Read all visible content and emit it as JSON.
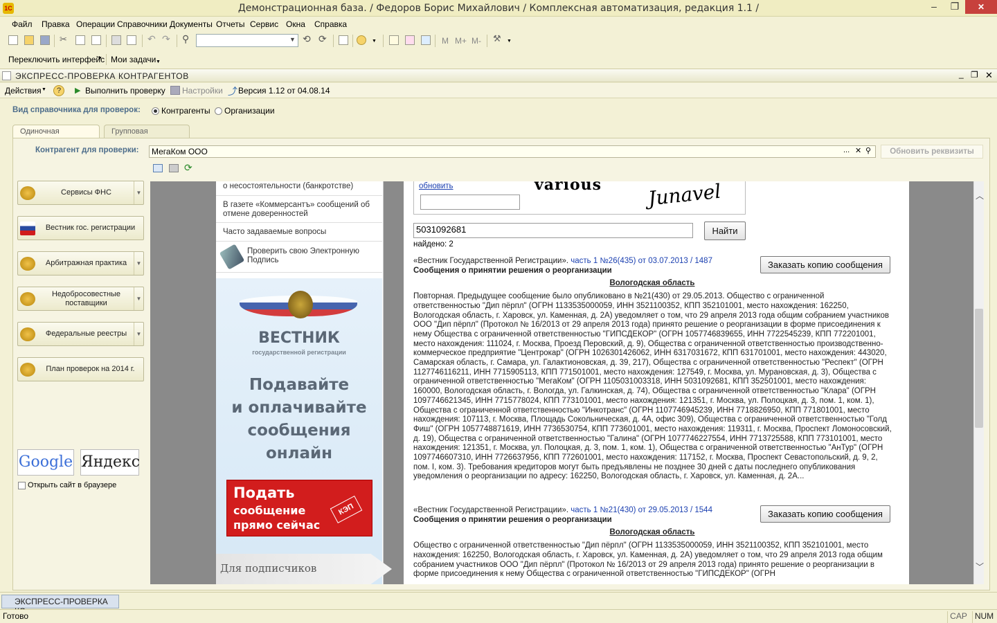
{
  "window": {
    "title": "Демонстрационная база. / Федоров Борис Михайлович /  Комплексная автоматизация, редакция 1.1 /",
    "app_icon": "1С",
    "minimize": "–",
    "restore": "❐",
    "close": "✕"
  },
  "menu": [
    "Файл",
    "Правка",
    "Операции",
    "Справочники",
    "Документы",
    "Отчеты",
    "Сервис",
    "Окна",
    "Справка"
  ],
  "toolbar2": {
    "switch_interface": "Переключить интерфейс",
    "my_tasks": "Мои задачи"
  },
  "toolbar": {
    "m1": "M",
    "m2": "M+",
    "m3": "M-",
    "search_value": ""
  },
  "document": {
    "title": "ЭКСПРЕСС-ПРОВЕРКА КОНТРАГЕНТОВ"
  },
  "actions": {
    "actions": "Действия",
    "help": "?",
    "run": "Выполнить проверку",
    "settings": "Настройки",
    "version": "Версия 1.12 от 04.08.14"
  },
  "ref_type": {
    "label": "Вид справочника для проверок:",
    "opt1": "Контрагенты",
    "opt2": "Организации",
    "selected": "Контрагенты"
  },
  "tabs": {
    "single": "Одиночная проверка",
    "group": "Групповая проверка",
    "active": "Одиночная проверка"
  },
  "contractor": {
    "label": "Контрагент для проверки:",
    "value": "МегаКом ООО",
    "refresh": "Обновить реквизиты",
    "dots": "...",
    "clear": "✕"
  },
  "services": [
    {
      "label": "Сервисы ФНС",
      "dropdown": true
    },
    {
      "label": "Вестник гос. регистрации",
      "dropdown": false
    },
    {
      "label": "Арбитражная практика",
      "dropdown": true
    },
    {
      "label": "Недобросовестные поставщики",
      "dropdown": true
    },
    {
      "label": "Федеральные реестры",
      "dropdown": true
    },
    {
      "label": "План проверок на 2014 г.",
      "dropdown": false
    }
  ],
  "search_engines": {
    "google": "Google",
    "yandex": "Яндекс"
  },
  "open_in_browser": "Открыть сайт в браузере",
  "web": {
    "links": {
      "bankruptcy": "о несостоятельности (банкротстве)",
      "kommersant": "В газете «Коммерсантъ» сообщений об отмене доверенностей",
      "faq": "Часто задаваемые вопросы",
      "ecp": "Проверить свою Электронную Подпись"
    },
    "banner": {
      "logo": "ВЕСТНИК",
      "logo_sub": "государственной регистрации",
      "slogan": [
        "Подавайте",
        "и оплачивайте",
        "сообщения",
        "онлайн"
      ],
      "cta": [
        "Подать",
        "сообщение",
        "прямо сейчас"
      ],
      "kep": "КЭП",
      "subscribers": "Для подписчиков"
    },
    "captcha": {
      "refresh": "обновить",
      "word1": "various",
      "word2": "Junavel",
      "input": ""
    },
    "search": {
      "value": "5031092681",
      "button": "Найти",
      "found": "найдено: 2"
    },
    "results": [
      {
        "source": "«Вестник Государственной Регистрации».",
        "ref": "часть 1 №26(435) от 03.07.2013 / 1487",
        "heading": "Сообщения о принятии решения о реорганизации",
        "region": "Вологодская область",
        "order": "Заказать копию сообщения",
        "text": "Повторная. Предыдущее сообщение было опубликовано в №21(430) от 29.05.2013. Общество с ограниченной ответственностью \"Дип пёрпл\" (ОГРН 1133535000059, ИНН 3521100352, КПП 352101001, место нахождения: 162250, Вологодская область, г. Харовск, ул. Каменная, д. 2А) уведомляет о том, что 29 апреля 2013 года общим собранием участников ООО \"Дип пёрпл\" (Протокол № 16/2013 от 29 апреля 2013 года) принято решение о реорганизации в форме присоединения к нему Общества с ограниченной ответственностью \"ГИПСДЕКОР\" (ОГРН 1057746839655, ИНН 7722545239, КПП 772201001, место нахождения: 111024, г. Москва, Проезд Перовский, д. 9), Общества с ограниченной ответственностью производственно-коммерческое предприятие \"Центрокар\" (ОГРН 1026301426062, ИНН 6317031672, КПП 631701001, место нахождения: 443020, Самарская область, г. Самара, ул. Галактионовская, д. 39, 217), Общества с ограниченной ответственностью \"Респект\" (ОГРН 1127746116211, ИНН 7715905113, КПП 771501001, место нахождения: 127549, г. Москва, ул. Мурановская, д. 3), Общества с ограниченной ответственностью \"МегаКом\" (ОГРН 1105031003318, ИНН 5031092681, КПП 352501001, место нахождения: 160000, Вологодская область, г. Вологда, ул. Галкинская, д. 74), Общества с ограниченной ответственностью \"Клара\" (ОГРН 1097746621345, ИНН 7715778024, КПП 773101001, место нахождения: 121351, г. Москва, ул. Полоцкая, д. 3, пом. 1, ком. 1), Общества с ограниченной ответственностью \"Инкотранс\" (ОГРН 1107746945239, ИНН 7718826950, КПП 771801001, место нахождения: 107113, г. Москва, Площадь Сокольническая, д. 4А, офис 309), Общества с ограниченной ответственностью \"Голд Фиш\" (ОГРН 1057748871619, ИНН 7736530754, КПП 773601001, место нахождения: 119311, г. Москва, Проспект Ломоносовский, д. 19), Общества с ограниченной ответственностью \"Галина\" (ОГРН 1077746227554, ИНН 7713725588, КПП 773101001, место нахождения: 121351, г. Москва, ул. Полоцкая, д. 3, пом. 1, ком. 1), Общества с ограниченной ответственностью \"АнТур\" (ОГРН 1097746607310, ИНН 7726637956, КПП 772601001, место нахождения: 117152, г. Москва, Проспект Севастопольский, д. 9, 2, пом. I, ком. 3). Требования кредиторов могут быть предъявлены не позднее 30 дней с даты последнего опубликования уведомления о реорганизации по адресу: 162250, Вологодская область, г. Харовск, ул. Каменная, д. 2А..."
      },
      {
        "source": "«Вестник Государственной Регистрации».",
        "ref": "часть 1 №21(430) от 29.05.2013 / 1544",
        "heading": "Сообщения о принятии решения о реорганизации",
        "region": "Вологодская область",
        "order": "Заказать копию сообщения",
        "text": "Общество с ограниченной ответственностью \"Дип пёрпл\" (ОГРН 1133535000059, ИНН 3521100352, КПП 352101001, место нахождения: 162250, Вологодская область, г. Харовск, ул. Каменная, д. 2А) уведомляет о том, что 29 апреля 2013 года общим собранием участников ООО \"Дип пёрпл\" (Протокол № 16/2013 от 29 апреля 2013 года) принято решение о реорганизации в форме присоединения к нему Общества с ограниченной ответственностью \"ГИПСДЕКОР\" (ОГРН"
      }
    ]
  },
  "taskbar": {
    "item": "ЭКСПРЕСС-ПРОВЕРКА КО..."
  },
  "status": {
    "ready": "Готово",
    "cap": "CAP",
    "num": "NUM"
  },
  "colors": {
    "chrome": "#f3f1d6",
    "label_blue": "#4d6d8b",
    "link_blue": "#1a3fb0",
    "banner_red": "#d21d1d",
    "close_red": "#c7413c"
  }
}
